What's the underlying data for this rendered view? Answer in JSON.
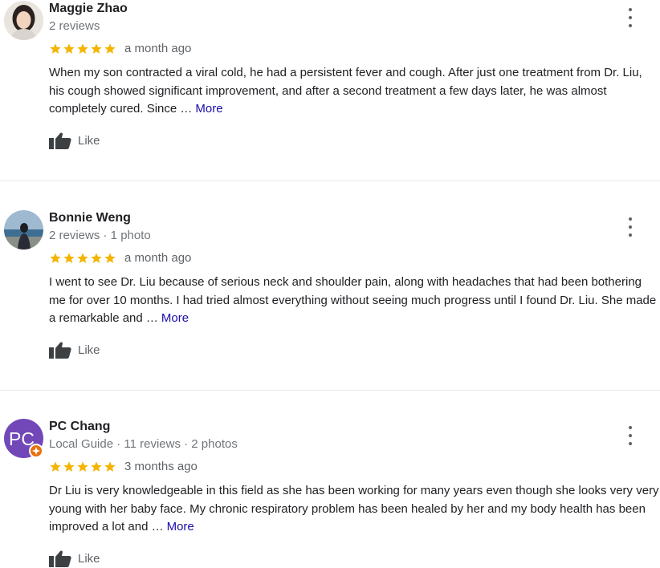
{
  "colors": {
    "star": "#f4b400",
    "link": "#1a0dab",
    "meta": "#70757a",
    "avatar_pc": "#7248b9",
    "local_guide_badge": "#e8710a"
  },
  "reviews": [
    {
      "name": "Maggie Zhao",
      "meta": "2 reviews",
      "rating": 5,
      "time": "a month ago",
      "text": "When my son contracted a viral cold, he had a persistent fever and cough. After just one treatment from Dr. Liu, his cough showed significant improvement, and after a second treatment a few days later, he was almost completely cured. Since …",
      "more": "More",
      "like": "Like",
      "avatar": "photo-avatar"
    },
    {
      "name": "Bonnie Weng",
      "meta": "2 reviews · 1 photo",
      "rating": 5,
      "time": "a month ago",
      "text": "I went to see Dr. Liu because of serious neck and shoulder pain, along with headaches that had been bothering me for over 10 months. I had tried almost everything without seeing much progress until I found Dr. Liu. She made a remarkable and …",
      "more": "More",
      "like": "Like",
      "avatar": "photo-avatar"
    },
    {
      "name": "PC Chang",
      "meta": "Local Guide · 11 reviews · 2 photos",
      "rating": 5,
      "time": "3 months ago",
      "text": "Dr Liu is very knowledgeable in this field as she has been working for many years even though she looks very very young with her baby face. My chronic respiratory problem has been healed by her and my body health has been improved a lot and …",
      "more": "More",
      "like": "Like",
      "avatar_initials": "PC"
    }
  ]
}
